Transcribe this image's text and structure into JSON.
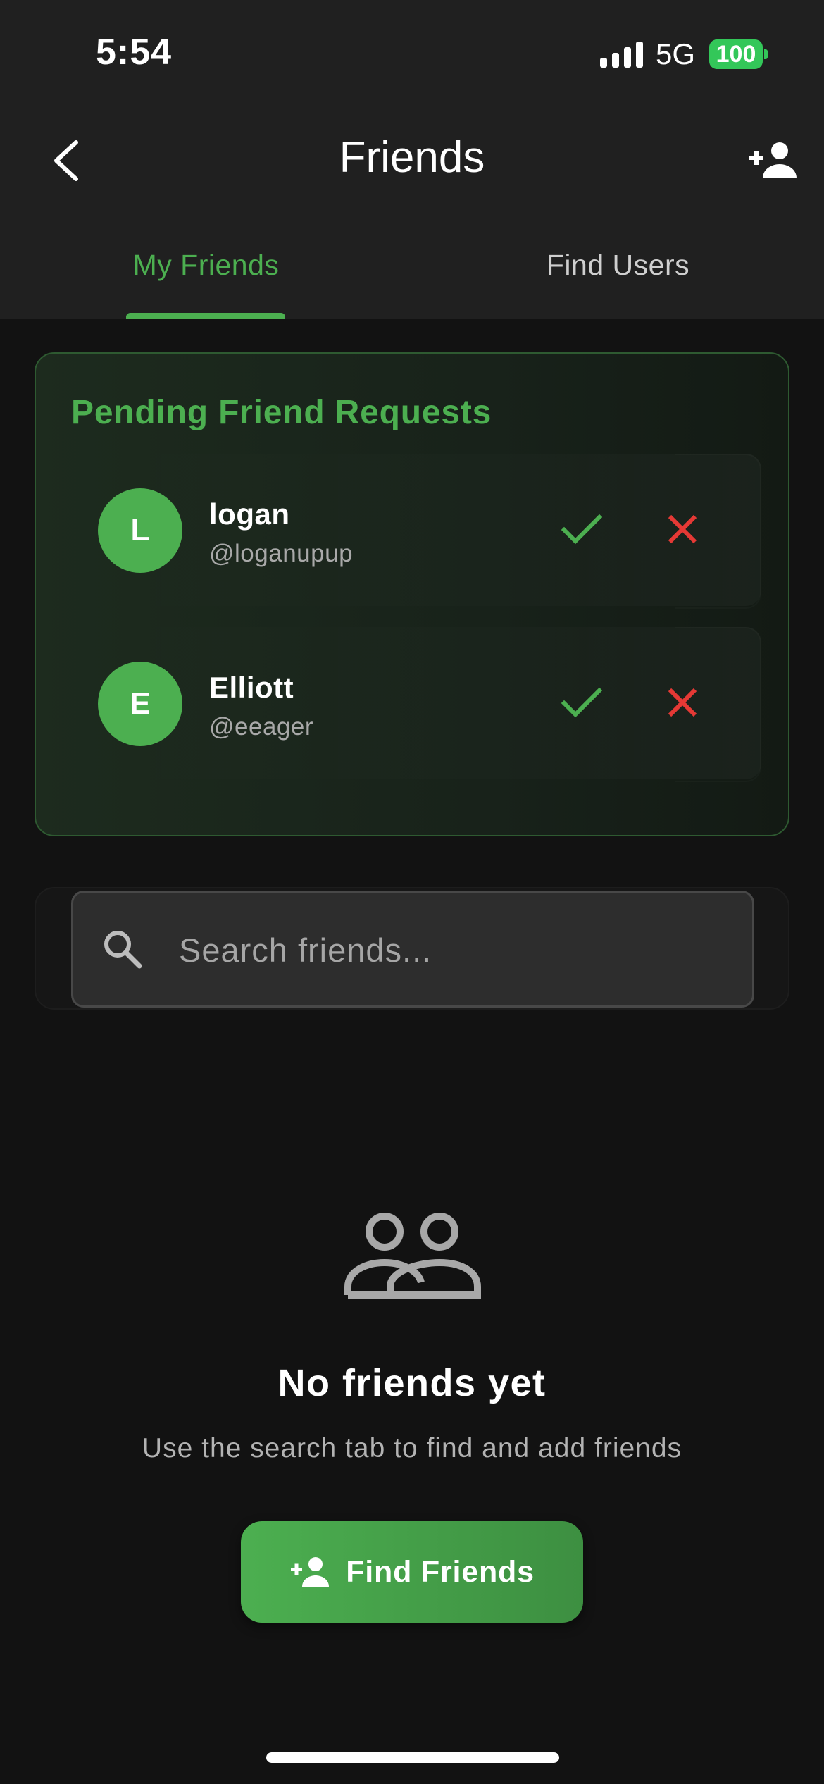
{
  "status_bar": {
    "time": "5:54",
    "network": "5G",
    "battery": "100"
  },
  "header": {
    "title": "Friends",
    "back_icon": "chevron-left-icon",
    "action_icon": "person-add-icon"
  },
  "tabs": [
    {
      "label": "My Friends",
      "active": true
    },
    {
      "label": "Find Users",
      "active": false
    }
  ],
  "pending": {
    "title": "Pending Friend Requests",
    "requests": [
      {
        "initial": "L",
        "name": "logan",
        "handle": "@loganupup"
      },
      {
        "initial": "E",
        "name": "Elliott",
        "handle": "@eeager"
      }
    ]
  },
  "search": {
    "placeholder": "Search friends...",
    "value": ""
  },
  "empty_state": {
    "icon": "people-outline-icon",
    "title": "No friends yet",
    "subtitle": "Use the search tab to find and add friends",
    "button_label": "Find Friends"
  },
  "colors": {
    "accent": "#4caf50",
    "decline": "#e53935",
    "background": "#121212",
    "surface": "#202020"
  }
}
